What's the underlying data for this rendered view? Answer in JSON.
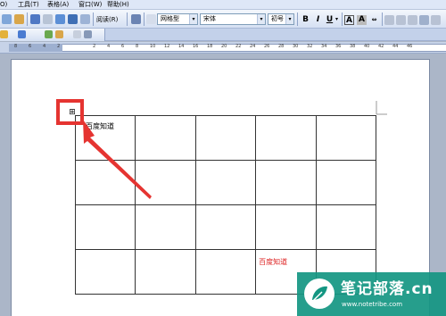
{
  "menubar": {
    "items": [
      "O)",
      "工具(T)",
      "表格(A)",
      "窗口(W)",
      "帮助(H)"
    ]
  },
  "toolbar": {
    "read_label": "阅读(R)",
    "style_value": "网格型",
    "font_value": "宋体",
    "size_value": "初号",
    "bold": "B",
    "italic": "I",
    "underline": "U",
    "font_color": "A",
    "char_border": "A",
    "char_shade": "A"
  },
  "ruler": {
    "left_numbers": [
      "8",
      "6",
      "4",
      "2"
    ],
    "right_numbers": [
      "2",
      "4",
      "6",
      "8",
      "10",
      "12",
      "14",
      "16",
      "18",
      "20",
      "22",
      "24",
      "26",
      "28",
      "30",
      "32",
      "34",
      "36",
      "38",
      "40",
      "42",
      "44",
      "46"
    ]
  },
  "document": {
    "table_handle_glyph": "⊞",
    "table": {
      "rows": [
        [
          "百度知道",
          "",
          "",
          "",
          ""
        ],
        [
          "",
          "",
          "",
          "",
          ""
        ],
        [
          "",
          "",
          "",
          "",
          ""
        ],
        [
          "",
          "",
          "",
          "百度知道",
          ""
        ]
      ]
    }
  },
  "watermark": {
    "title": "笔记部落.cn",
    "url": "www.notetribe.com"
  },
  "colors": {
    "highlight": "#e53431",
    "red_text": "#dd2222",
    "watermark_bg": "#149682"
  }
}
